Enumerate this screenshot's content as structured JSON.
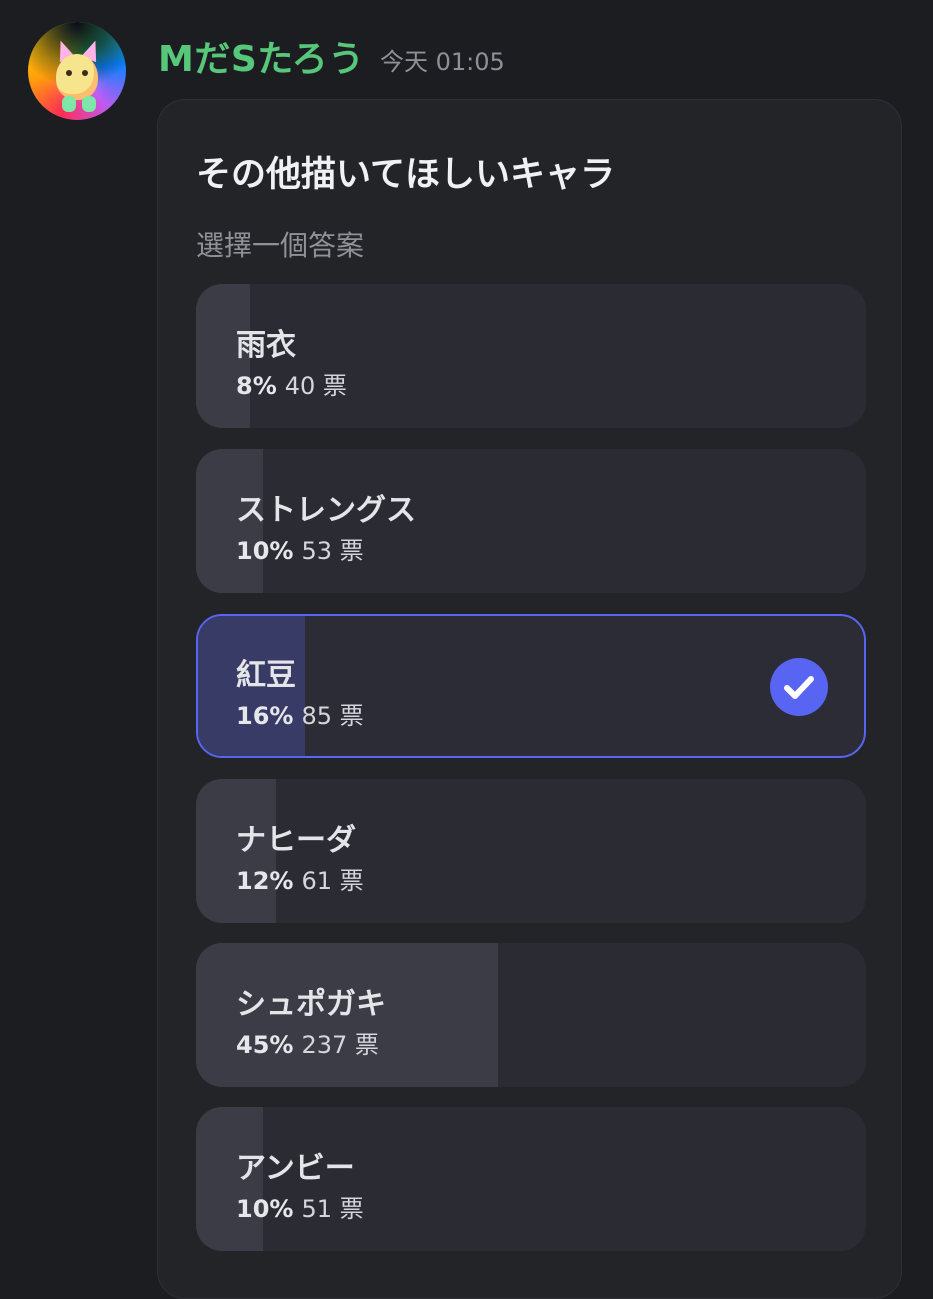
{
  "message": {
    "username": "MだSたろう",
    "timestamp": "今天 01:05",
    "avatar_icon": "avatar-rainbow-cat"
  },
  "poll": {
    "title": "その他描いてほしいキャラ",
    "subtitle": "選擇一個答案",
    "accent_color": "#5865f2",
    "options": [
      {
        "label": "雨衣",
        "percent": "8%",
        "percent_value": 0.08,
        "votes": "40 票",
        "selected": false
      },
      {
        "label": "ストレングス",
        "percent": "10%",
        "percent_value": 0.1,
        "votes": "53 票",
        "selected": false
      },
      {
        "label": "紅豆",
        "percent": "16%",
        "percent_value": 0.16,
        "votes": "85 票",
        "selected": true
      },
      {
        "label": "ナヒーダ",
        "percent": "12%",
        "percent_value": 0.12,
        "votes": "61 票",
        "selected": false
      },
      {
        "label": "シュポガキ",
        "percent": "45%",
        "percent_value": 0.45,
        "votes": "237 票",
        "selected": false
      },
      {
        "label": "アンビー",
        "percent": "10%",
        "percent_value": 0.1,
        "votes": "51 票",
        "selected": false
      }
    ]
  }
}
